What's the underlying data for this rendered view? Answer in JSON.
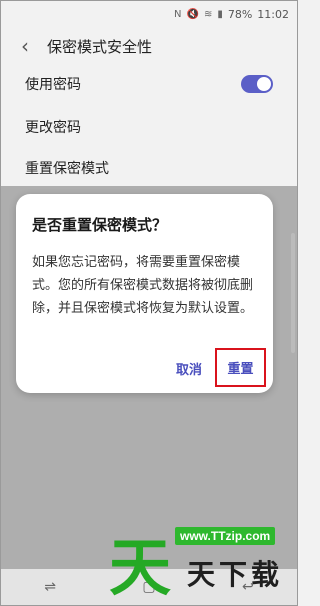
{
  "status_bar": {
    "icons": [
      "nfc-icon",
      "mute-icon",
      "wifi-icon",
      "signal-icon"
    ],
    "battery": "78%",
    "time": "11:02"
  },
  "app_bar": {
    "title": "保密模式安全性"
  },
  "settings": [
    {
      "label": "使用密码",
      "toggle": true
    },
    {
      "label": "更改密码"
    },
    {
      "label": "重置保密模式"
    }
  ],
  "dialog": {
    "title": "是否重置保密模式？",
    "body": "如果您忘记密码，将需要重置保密模式。您的所有保密模式数据将被彻底删除，并且保密模式将恢复为默认设置。",
    "cancel_label": "取消",
    "reset_label": "重置"
  },
  "watermark": {
    "url": "www.TTzip.com",
    "chars": [
      "天",
      "天",
      "下",
      "载"
    ]
  },
  "colors": {
    "accent": "#5b5fc7",
    "highlight": "#d9131c",
    "watermark_green": "#2eb82e"
  }
}
